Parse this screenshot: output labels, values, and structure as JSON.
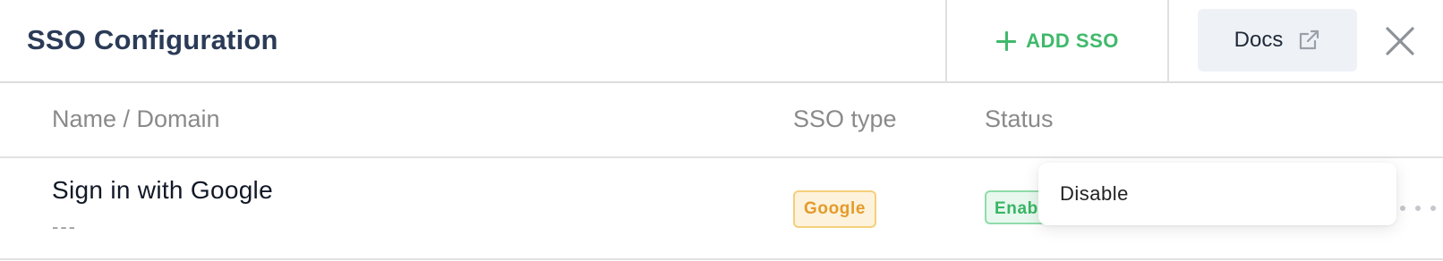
{
  "header": {
    "title": "SSO Configuration",
    "add_label": "ADD SSO",
    "docs_label": "Docs"
  },
  "table": {
    "columns": [
      "Name / Domain",
      "SSO type",
      "Status"
    ],
    "rows": [
      {
        "name": "Sign in with Google",
        "domain": "---",
        "sso_type": "Google",
        "status": "Enabled"
      }
    ]
  },
  "dropdown": {
    "items": [
      "Disable"
    ]
  },
  "colors": {
    "title": "#2b3b57",
    "accent_green": "#3fb96b",
    "google_badge": "#e49b2a",
    "status_badge": "#39b566",
    "docs_bg": "#eef2f7"
  },
  "icons": {
    "add": "plus-icon",
    "docs": "external-link-icon",
    "close": "close-icon",
    "more": "more-horizontal-icon"
  }
}
